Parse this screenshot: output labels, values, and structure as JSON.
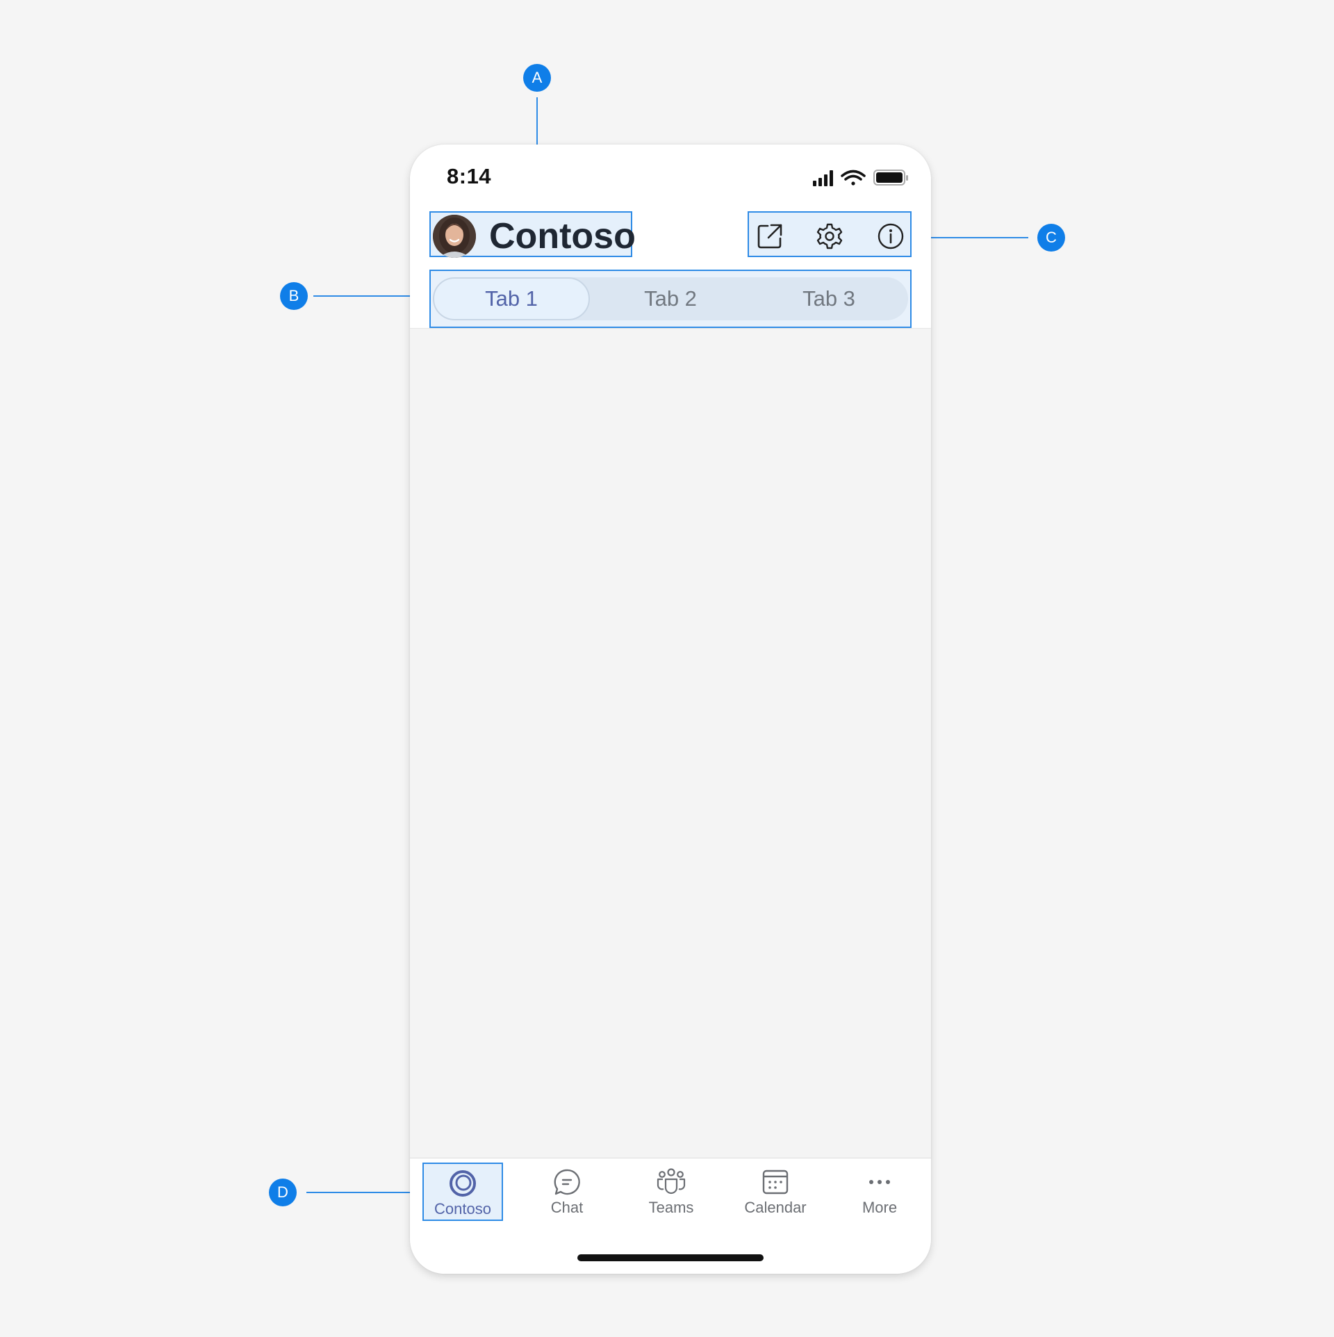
{
  "status_bar": {
    "time": "8:14"
  },
  "header": {
    "app_title": "Contoso",
    "avatar_icon": "user-avatar",
    "actions": [
      {
        "name": "open-external-icon"
      },
      {
        "name": "settings-gear-icon"
      },
      {
        "name": "info-icon"
      }
    ]
  },
  "tabs": [
    {
      "label": "Tab 1",
      "selected": true
    },
    {
      "label": "Tab 2",
      "selected": false
    },
    {
      "label": "Tab 3",
      "selected": false
    }
  ],
  "bottom_nav": [
    {
      "label": "Contoso",
      "icon": "contoso-logo-icon",
      "selected": true
    },
    {
      "label": "Chat",
      "icon": "chat-bubble-icon",
      "selected": false
    },
    {
      "label": "Teams",
      "icon": "teams-people-icon",
      "selected": false
    },
    {
      "label": "Calendar",
      "icon": "calendar-icon",
      "selected": false
    },
    {
      "label": "More",
      "icon": "more-dots-icon",
      "selected": false
    }
  ],
  "callouts": {
    "a": "A",
    "b": "B",
    "c": "C",
    "d": "D"
  },
  "colors": {
    "annotation_blue": "#0f7ee8",
    "accent_purple": "#5263a8",
    "page_background": "#f5f5f5"
  }
}
